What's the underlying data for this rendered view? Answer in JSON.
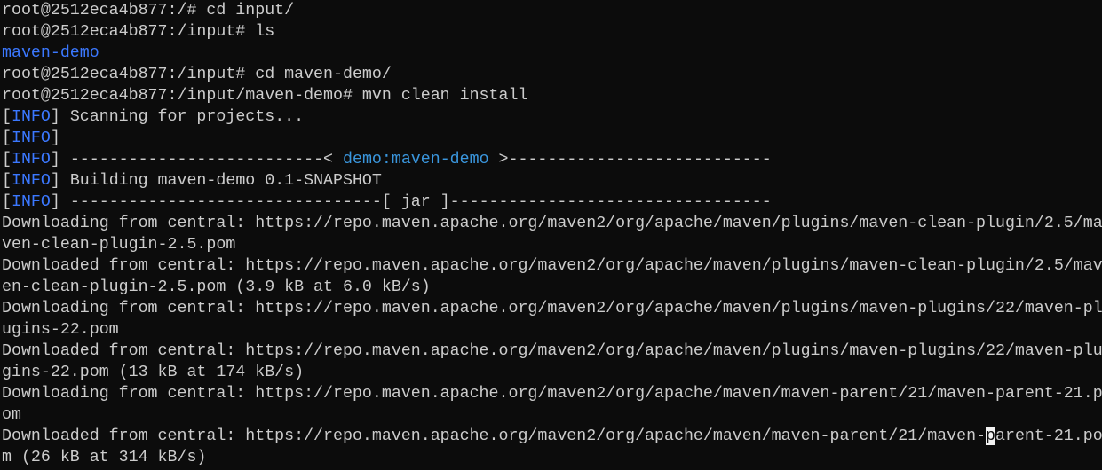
{
  "colors": {
    "background": "#0c0c0c",
    "text": "#cccccc",
    "info": "#3b78ff",
    "directory": "#3b78ff",
    "artifact": "#3a96dd",
    "cursor": "#f2f2f2"
  },
  "lines": [
    [
      {
        "t": "root@2512eca4b877:/# cd input/"
      }
    ],
    [
      {
        "t": "root@2512eca4b877:/input# ls"
      }
    ],
    [
      {
        "t": "maven-demo",
        "c": "blue"
      }
    ],
    [
      {
        "t": "root@2512eca4b877:/input# cd maven-demo/"
      }
    ],
    [
      {
        "t": "root@2512eca4b877:/input/maven-demo# mvn clean install"
      }
    ],
    [
      {
        "t": "["
      },
      {
        "t": "INFO",
        "c": "blue"
      },
      {
        "t": "] Scanning for projects..."
      }
    ],
    [
      {
        "t": "["
      },
      {
        "t": "INFO",
        "c": "blue"
      },
      {
        "t": "]"
      }
    ],
    [
      {
        "t": "["
      },
      {
        "t": "INFO",
        "c": "blue"
      },
      {
        "t": "] --------------------------< "
      },
      {
        "t": "demo:maven-demo",
        "c": "cyan"
      },
      {
        "t": " >---------------------------"
      }
    ],
    [
      {
        "t": "["
      },
      {
        "t": "INFO",
        "c": "blue"
      },
      {
        "t": "] Building maven-demo 0.1-SNAPSHOT"
      }
    ],
    [
      {
        "t": "["
      },
      {
        "t": "INFO",
        "c": "blue"
      },
      {
        "t": "] --------------------------------[ jar ]---------------------------------"
      }
    ],
    [
      {
        "t": "Downloading from central: https://repo.maven.apache.org/maven2/org/apache/maven/plugins/maven-clean-plugin/2.5/ma"
      }
    ],
    [
      {
        "t": "ven-clean-plugin-2.5.pom"
      }
    ],
    [
      {
        "t": "Downloaded from central: https://repo.maven.apache.org/maven2/org/apache/maven/plugins/maven-clean-plugin/2.5/mav"
      }
    ],
    [
      {
        "t": "en-clean-plugin-2.5.pom (3.9 kB at 6.0 kB/s)"
      }
    ],
    [
      {
        "t": "Downloading from central: https://repo.maven.apache.org/maven2/org/apache/maven/plugins/maven-plugins/22/maven-pl"
      }
    ],
    [
      {
        "t": "ugins-22.pom"
      }
    ],
    [
      {
        "t": "Downloaded from central: https://repo.maven.apache.org/maven2/org/apache/maven/plugins/maven-plugins/22/maven-plu"
      }
    ],
    [
      {
        "t": "gins-22.pom (13 kB at 174 kB/s)"
      }
    ],
    [
      {
        "t": "Downloading from central: https://repo.maven.apache.org/maven2/org/apache/maven/maven-parent/21/maven-parent-21.p"
      }
    ],
    [
      {
        "t": "om"
      }
    ],
    [
      {
        "t": "Downloaded from central: https://repo.maven.apache.org/maven2/org/apache/maven/maven-parent/21/maven-"
      },
      {
        "t": "p",
        "c": "cursor"
      },
      {
        "t": "arent-21.po"
      }
    ],
    [
      {
        "t": "m (26 kB at 314 kB/s)"
      }
    ]
  ]
}
